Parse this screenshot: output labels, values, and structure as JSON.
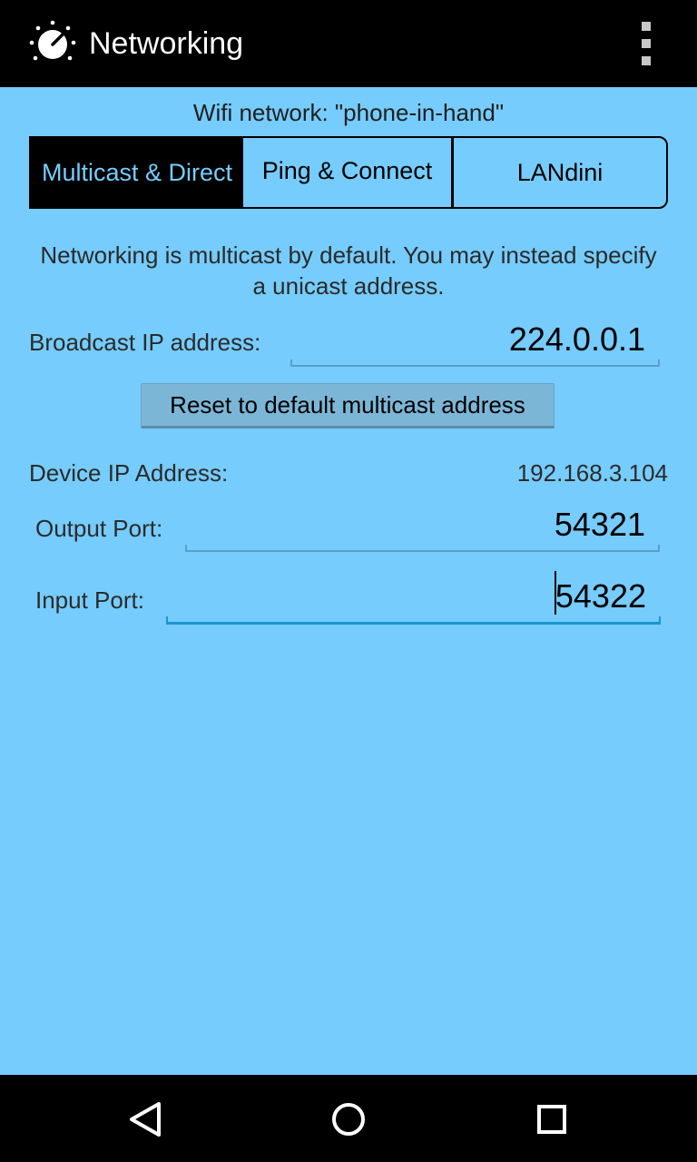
{
  "app": {
    "title": "Networking",
    "icon": "knob-icon",
    "menu_icon": "overflow-menu-icon"
  },
  "wifi_label": "Wifi network: \"phone-in-hand\"",
  "tabs": [
    {
      "label": "Multicast & Direct",
      "selected": true
    },
    {
      "label": "Ping & Connect",
      "selected": false
    },
    {
      "label": "LANdini",
      "selected": false
    }
  ],
  "description": "Networking is multicast by default. You may instead specify a unicast address.",
  "broadcast": {
    "label": "Broadcast IP address:",
    "value": "224.0.0.1"
  },
  "reset_button": "Reset to default multicast address",
  "device_ip": {
    "label": "Device IP Address:",
    "value": "192.168.3.104"
  },
  "output_port": {
    "label": "Output Port:",
    "value": "54321"
  },
  "input_port": {
    "label": "Input Port:",
    "value": "54322",
    "focused": true
  },
  "navbar": {
    "back": "back-icon",
    "home": "home-icon",
    "recents": "recents-icon"
  },
  "colors": {
    "background": "#76ccfc",
    "action_bar": "#000000",
    "accent": "#1a96d0"
  }
}
